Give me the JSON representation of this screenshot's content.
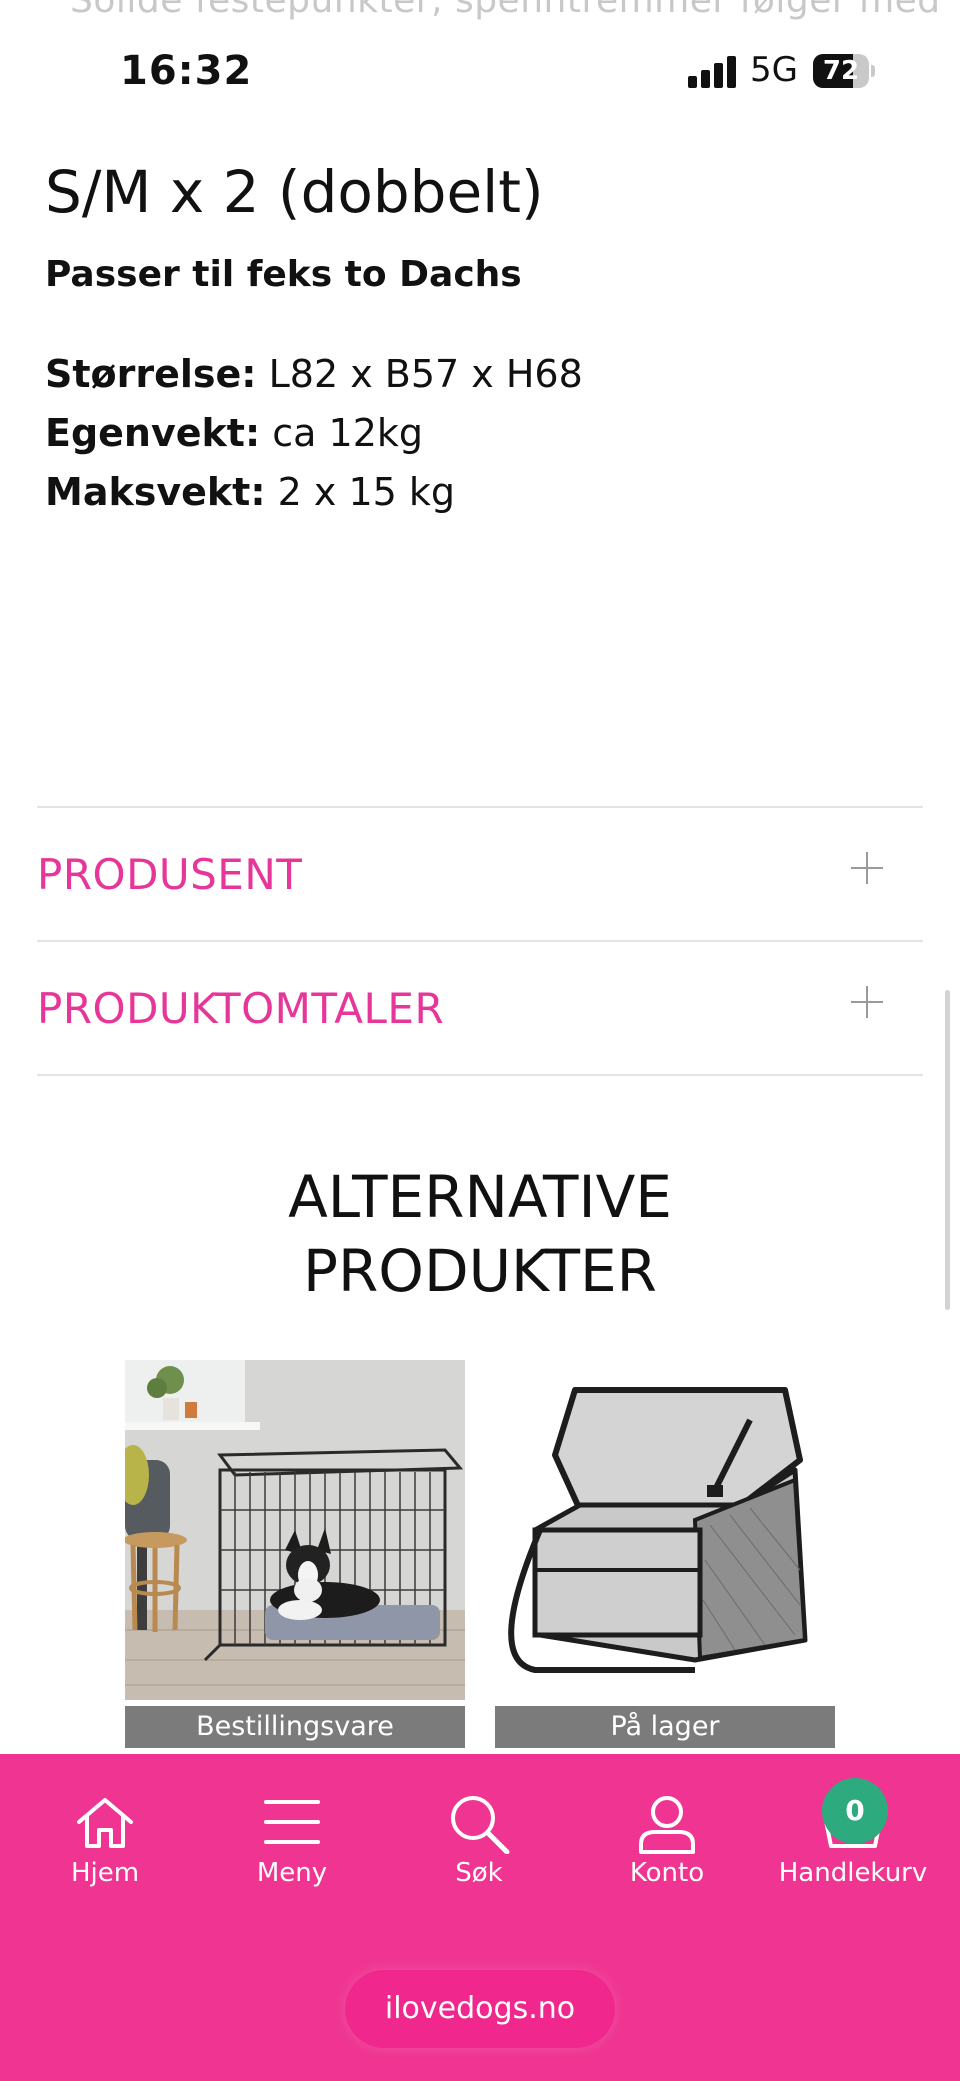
{
  "peek": {
    "text": "Solide festepunkter, spenntremmer følger med"
  },
  "status_bar": {
    "time": "16:32",
    "network": "5G",
    "battery": "72",
    "battery_level": 0.72
  },
  "variant": {
    "title": "S/M x 2 (dobbelt)",
    "subtitle": "Passer til feks to Dachs",
    "specs": [
      {
        "label": "Størrelse:",
        "value": "L82 x B57 x H68"
      },
      {
        "label": "Egenvekt:",
        "value": "ca 12kg"
      },
      {
        "label": "Maksvekt:",
        "value": "2 x 15 kg"
      }
    ]
  },
  "accordion": [
    {
      "label": "PRODUSENT"
    },
    {
      "label": "PRODUKTOMTALER"
    }
  ],
  "alternatives": {
    "title_line1": "ALTERNATIVE",
    "title_line2": "PRODUKTER",
    "products": [
      {
        "badge": "Bestillingsvare",
        "image": "dog-crate-image"
      },
      {
        "badge": "På lager",
        "image": "dog-car-seat-image"
      }
    ]
  },
  "bottom_nav": {
    "items": [
      {
        "label": "Hjem",
        "icon": "home-icon"
      },
      {
        "label": "Meny",
        "icon": "menu-icon"
      },
      {
        "label": "Søk",
        "icon": "search-icon"
      },
      {
        "label": "Konto",
        "icon": "account-icon"
      },
      {
        "label": "Handlekurv",
        "icon": "basket-icon"
      }
    ],
    "cart_count": "0"
  },
  "browser": {
    "url": "ilovedogs.no"
  },
  "colors": {
    "accent": "#ef3591",
    "accordion_text": "#e7369a",
    "badge_bg": "#7b7b7b",
    "cart_badge": "#2eaa7f"
  }
}
